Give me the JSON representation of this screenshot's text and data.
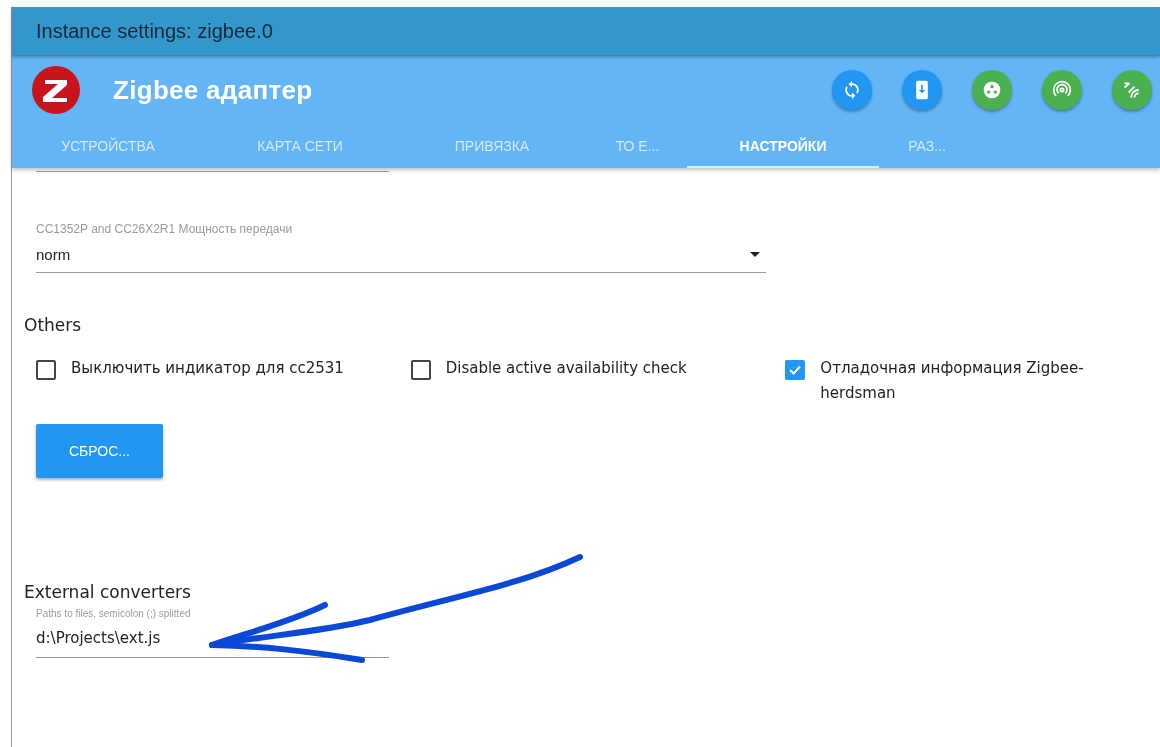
{
  "dialog": {
    "title": "Instance settings: zigbee.0"
  },
  "app": {
    "title": "Zigbee адаптер",
    "actions": [
      {
        "kind": "sync",
        "color": "#2196f3"
      },
      {
        "kind": "download",
        "color": "#2196f3"
      },
      {
        "kind": "dots",
        "color": "#4caf50"
      },
      {
        "kind": "broadcast",
        "color": "#4caf50"
      },
      {
        "kind": "signal",
        "color": "#4caf50"
      }
    ]
  },
  "tabs": [
    {
      "label": "УСТРОЙСТВА",
      "selected": false
    },
    {
      "label": "КАРТА СЕТИ",
      "selected": false
    },
    {
      "label": "ПРИВЯЗКА",
      "selected": false
    },
    {
      "label": "ТО Е...",
      "selected": false
    },
    {
      "label": "НАСТРОЙКИ",
      "selected": true
    },
    {
      "label": "РАЗ...",
      "selected": false
    }
  ],
  "power_select": {
    "label": "CC1352P and CC26X2R1 Мощность передачи",
    "value": "norm"
  },
  "others": {
    "heading": "Others",
    "options": [
      {
        "label": "Выключить индикатор для cc2531",
        "checked": false
      },
      {
        "label": "Disable active availability check",
        "checked": false
      },
      {
        "label": "Отладочная информация Zigbee-herdsman",
        "checked": true
      }
    ],
    "reset_button": "СБРОС..."
  },
  "external_converters": {
    "heading": "External converters",
    "label": "Paths to files, semicolon (;) splitted",
    "value": "d:\\Projects\\ext.js"
  }
}
